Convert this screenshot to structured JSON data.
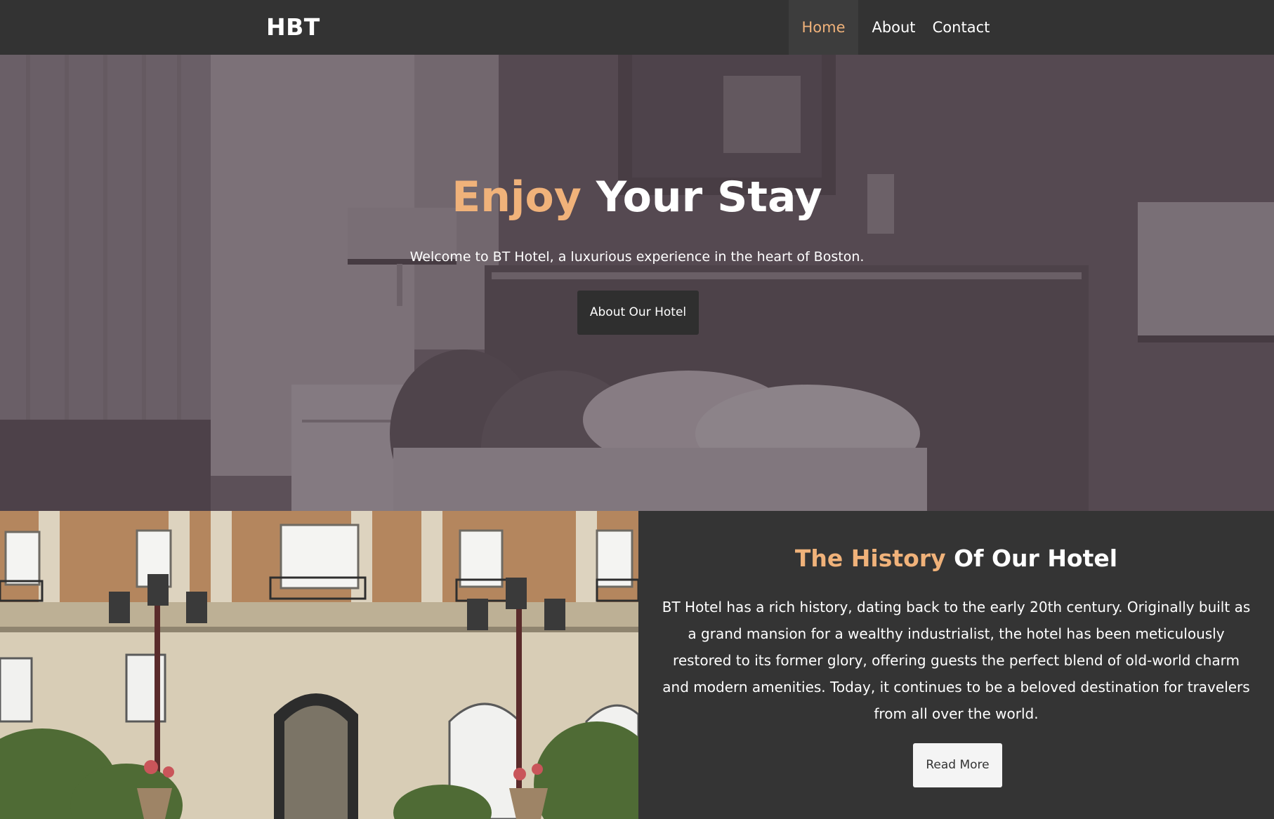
{
  "navbar": {
    "brand": "HBT",
    "links": [
      {
        "label": "Home",
        "active": true
      },
      {
        "label": "About",
        "active": false
      },
      {
        "label": "Contact",
        "active": false
      }
    ]
  },
  "hero": {
    "title_accent": "Enjoy",
    "title_rest": "Your Stay",
    "subtitle": "Welcome to BT Hotel, a luxurious experience in the heart of Boston.",
    "button_label": "About Our Hotel"
  },
  "history": {
    "title_accent": "The History",
    "title_rest": "Of Our Hotel",
    "body": "BT Hotel has a rich history, dating back to the early 20th century. Originally built as a grand mansion for a wealthy industrialist, the hotel has been meticulously restored to its former glory, offering guests the perfect blend of old-world charm and modern amenities. Today, it continues to be a beloved destination for travelers from all over the world.",
    "button_label": "Read More"
  },
  "colors": {
    "accent": "#f0b27a",
    "navbar_bg": "#333333",
    "section_bg": "#343434"
  }
}
